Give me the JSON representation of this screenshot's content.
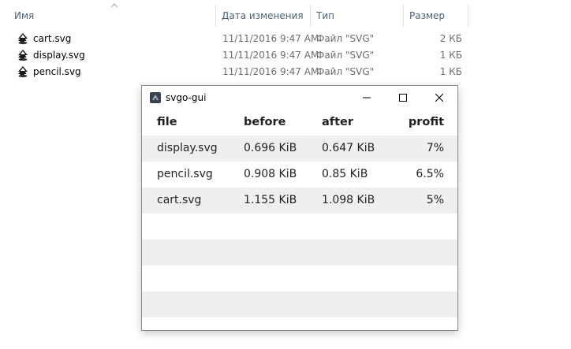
{
  "explorer": {
    "columns": {
      "name": "Имя",
      "date": "Дата изменения",
      "type": "Тип",
      "size": "Размер"
    },
    "files": [
      {
        "name": "cart.svg",
        "date": "11/11/2016 9:47 AM",
        "type": "Файл \"SVG\"",
        "size": "2 КБ",
        "icon": "inkscape-svg-icon"
      },
      {
        "name": "display.svg",
        "date": "11/11/2016 9:47 AM",
        "type": "Файл \"SVG\"",
        "size": "1 КБ",
        "icon": "inkscape-svg-icon"
      },
      {
        "name": "pencil.svg",
        "date": "11/11/2016 9:47 AM",
        "type": "Файл \"SVG\"",
        "size": "1 КБ",
        "icon": "inkscape-svg-icon"
      }
    ]
  },
  "window": {
    "title": "svgo-gui",
    "icon": "svgo-app-icon",
    "table": {
      "headers": {
        "file": "file",
        "before": "before",
        "after": "after",
        "profit": "profit"
      },
      "rows": [
        {
          "file": "display.svg",
          "before": "0.696 KiB",
          "after": "0.647 KiB",
          "profit": "7%"
        },
        {
          "file": "pencil.svg",
          "before": "0.908 KiB",
          "after": "0.85 KiB",
          "profit": "6.5%"
        },
        {
          "file": "cart.svg",
          "before": "1.155 KiB",
          "after": "1.098 KiB",
          "profit": "5%"
        }
      ]
    }
  }
}
